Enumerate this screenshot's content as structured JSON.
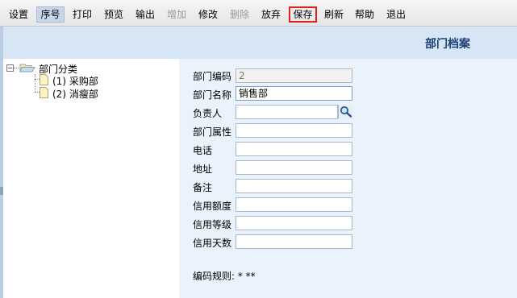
{
  "toolbar": {
    "buttons": [
      {
        "label": "设置",
        "state": "normal"
      },
      {
        "label": "序号",
        "state": "active"
      },
      {
        "label": "打印",
        "state": "normal"
      },
      {
        "label": "预览",
        "state": "normal"
      },
      {
        "label": "输出",
        "state": "normal"
      },
      {
        "label": "增加",
        "state": "disabled"
      },
      {
        "label": "修改",
        "state": "normal"
      },
      {
        "label": "删除",
        "state": "disabled"
      },
      {
        "label": "放弃",
        "state": "normal"
      },
      {
        "label": "保存",
        "state": "highlighted"
      },
      {
        "label": "刷新",
        "state": "normal"
      },
      {
        "label": "帮助",
        "state": "normal"
      },
      {
        "label": "退出",
        "state": "normal"
      }
    ]
  },
  "header": {
    "title": "部门档案"
  },
  "tree": {
    "root_label": "部门分类",
    "items": [
      {
        "label": "(1) 采购部"
      },
      {
        "label": "(2) 消瘦部"
      }
    ]
  },
  "form": {
    "fields": [
      {
        "label": "部门编码",
        "value": "2",
        "readonly": true
      },
      {
        "label": "部门名称",
        "value": "销售部"
      },
      {
        "label": "负责人",
        "value": "",
        "lookup_icon": "search-icon"
      },
      {
        "label": "部门属性",
        "value": ""
      },
      {
        "label": "电话",
        "value": ""
      },
      {
        "label": "地址",
        "value": ""
      },
      {
        "label": "备注",
        "value": ""
      },
      {
        "label": "信用额度",
        "value": ""
      },
      {
        "label": "信用等级",
        "value": ""
      },
      {
        "label": "信用天数",
        "value": ""
      }
    ],
    "rule": "编码规则: * **"
  },
  "colors": {
    "header_band": "#d6e6f4",
    "form_background": "#eaf3fc",
    "title_text": "#1d3f74",
    "save_highlight": "#e02020"
  }
}
